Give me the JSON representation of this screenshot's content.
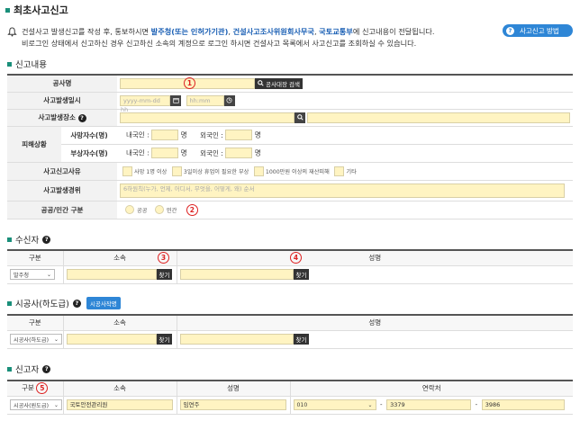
{
  "page_title": "최초사고신고",
  "help_button": "사고신고 방법",
  "notice": {
    "line1_pre": "건설사고 발생신고를 작성 후, 통보하시면 ",
    "line1_hl1": "발주청(또는 인허가기관)",
    "line1_sep1": ", ",
    "line1_hl2": "건설사고조사위원회사무국",
    "line1_sep2": ", ",
    "line1_hl3": "국토교통부",
    "line1_post": "에 신고내용이 전달됩니다.",
    "line2": "비로그인 상태에서 신고하신 경우 신고하신 소속의 계정으로 로그인 하시면 건설사고 목록에서 사고신고를 조회하실 수 있습니다."
  },
  "sections": {
    "report": "신고내용",
    "receiver": "수신자",
    "subcontractor": "시공사(하도급)",
    "subcontractor_btn": "시공사작명",
    "reporter": "신고자"
  },
  "form": {
    "project_name": "공사명",
    "search_button": "공사대장 검색",
    "accident_date": "사고발생일시",
    "date_placeholder": "yyyy-mm-dd hh",
    "time_placeholder": "hh:mm",
    "accident_place": "사고발생장소",
    "damage": "피해상황",
    "deaths": "사망자수(명)",
    "injured": "부상자수(명)",
    "domestic": "내국인 :",
    "foreign": "외국인 :",
    "unit": "명",
    "reason": "사고신고사유",
    "reason_opts": [
      "사망 1명 이상",
      "3일이상 휴업이 필요한 부상",
      "1000만원 이상의 재산피해",
      "기타"
    ],
    "details": "사고발생경위",
    "details_placeholder": "6하원칙(누가, 언제, 어디서, 무엇을, 어떻게, 왜) 순서",
    "public_private": "공공/민간 구분",
    "public": "공공",
    "private": "민간"
  },
  "receiver_table": {
    "col_type": "구분",
    "col_org": "소속",
    "col_name": "성명",
    "type_value": "발주청",
    "find": "찾기"
  },
  "sub_table": {
    "col_type": "구분",
    "col_org": "소속",
    "col_name": "성명",
    "type_value": "시공사(하도급)",
    "find": "찾기"
  },
  "reporter_table": {
    "col_type": "구분",
    "col_org": "소속",
    "col_name": "성명",
    "col_contact": "연락처",
    "type_value": "시공사(원도급)",
    "org_value": "국토안전관리원",
    "name_value": "임연주",
    "phone1": "010",
    "phone2": "3379",
    "phone3": "3986",
    "dash": "-"
  },
  "markers": [
    "1",
    "2",
    "3",
    "4",
    "5"
  ]
}
